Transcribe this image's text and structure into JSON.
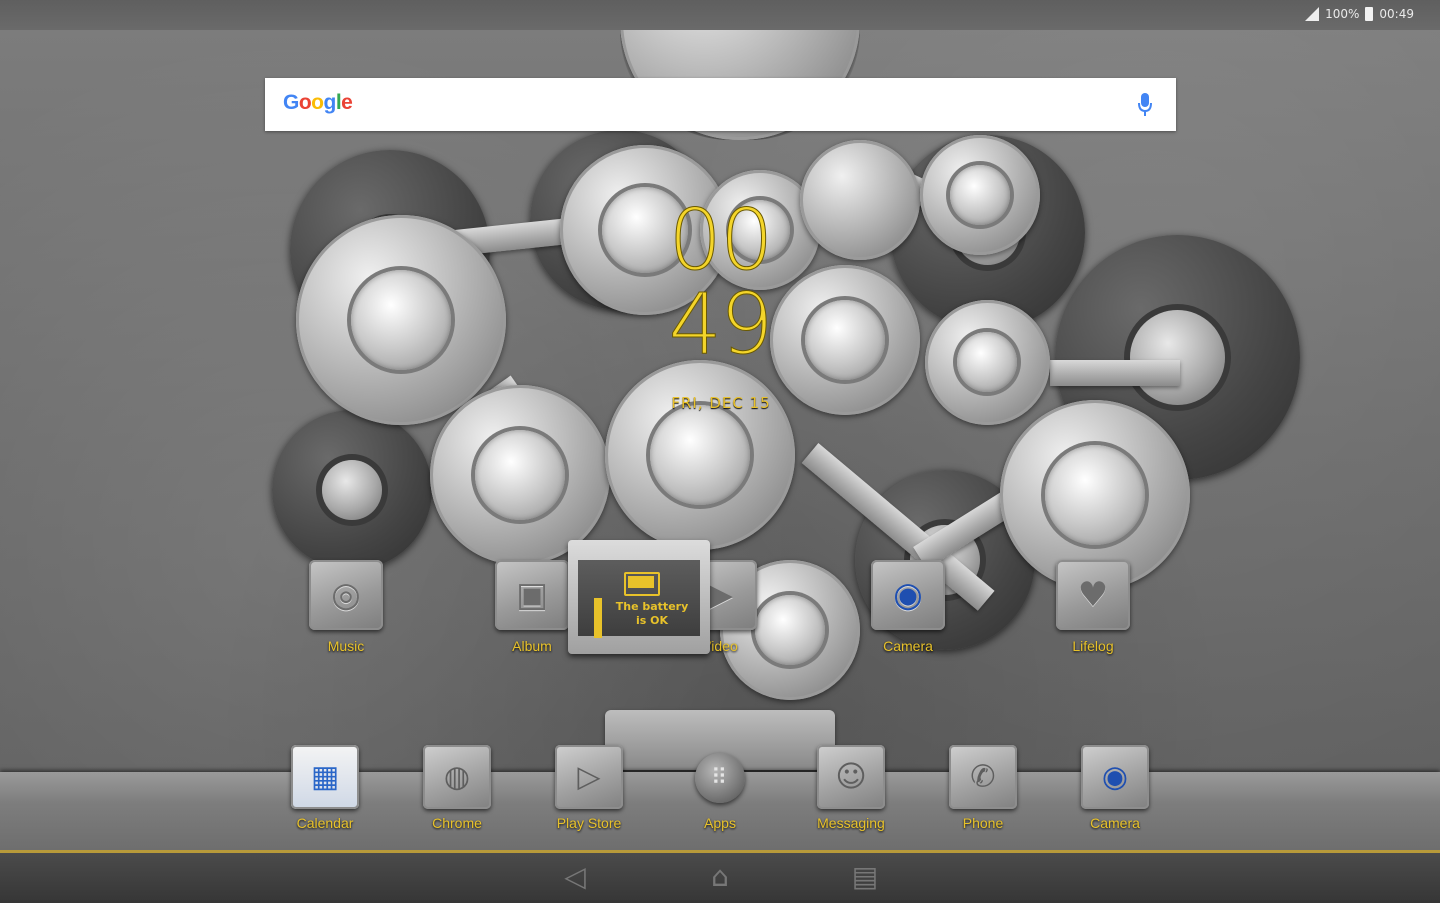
{
  "status_bar": {
    "battery_text": "100%",
    "time": "00:49"
  },
  "search": {
    "logo_letters": [
      "G",
      "o",
      "o",
      "g",
      "l",
      "e"
    ]
  },
  "clock": {
    "hours": "00",
    "minutes": "49",
    "date": "FRI, DEC 15"
  },
  "battery_widget": {
    "message_line1": "The battery",
    "message_line2": "is OK"
  },
  "home_apps": [
    {
      "label": "Music",
      "icon": "music-disc-icon"
    },
    {
      "label": "Album",
      "icon": "album-photo-icon"
    },
    {
      "label": "Video",
      "icon": "video-play-icon"
    },
    {
      "label": "Camera",
      "icon": "camera-icon"
    },
    {
      "label": "Lifelog",
      "icon": "heart-icon"
    }
  ],
  "dock_apps": [
    {
      "label": "Calendar",
      "icon": "calendar-icon"
    },
    {
      "label": "Chrome",
      "icon": "chrome-icon"
    },
    {
      "label": "Play Store",
      "icon": "play-store-icon"
    },
    {
      "label": "Apps",
      "icon": "apps-grid-icon"
    },
    {
      "label": "Messaging",
      "icon": "messaging-icon"
    },
    {
      "label": "Phone",
      "icon": "phone-icon"
    },
    {
      "label": "Camera",
      "icon": "camera-icon"
    }
  ],
  "nav_bar": {
    "buttons": [
      "back-icon",
      "home-icon",
      "recents-icon"
    ]
  },
  "colors": {
    "label_gold": "#e8c22a",
    "clock_yellow": "#f4d52a"
  }
}
